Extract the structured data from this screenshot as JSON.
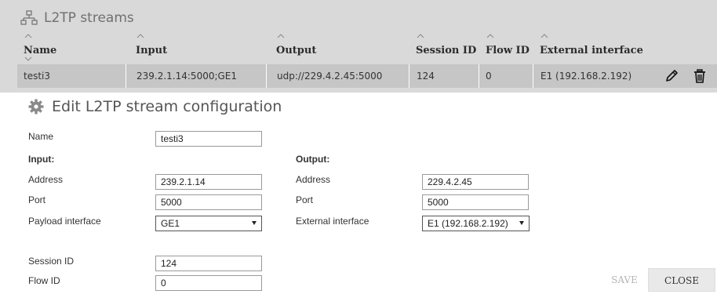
{
  "panel": {
    "title": "L2TP streams",
    "icon": "network-icon"
  },
  "table": {
    "columns": [
      "Name",
      "Input",
      "Output",
      "Session ID",
      "Flow ID",
      "External interface"
    ],
    "rows": [
      {
        "name": "testi3",
        "input": "239.2.1.14:5000;GE1",
        "output": "udp://229.4.2.45:5000",
        "session_id": "124",
        "flow_id": "0",
        "external_interface": "E1 (192.168.2.192)"
      }
    ]
  },
  "form": {
    "title": "Edit L2TP stream configuration",
    "icon": "gear-icon",
    "name_label": "Name",
    "name_value": "testi3",
    "input_heading": "Input:",
    "output_heading": "Output:",
    "input": {
      "address_label": "Address",
      "address_value": "239.2.1.14",
      "port_label": "Port",
      "port_value": "5000",
      "payload_label": "Payload interface",
      "payload_value": "GE1"
    },
    "output": {
      "address_label": "Address",
      "address_value": "229.4.2.45",
      "port_label": "Port",
      "port_value": "5000",
      "ext_label": "External interface",
      "ext_value": "E1 (192.168.2.192)"
    },
    "session_label": "Session ID",
    "session_value": "124",
    "flow_label": "Flow ID",
    "flow_value": "0"
  },
  "buttons": {
    "save": "SAVE",
    "close": "CLOSE"
  }
}
